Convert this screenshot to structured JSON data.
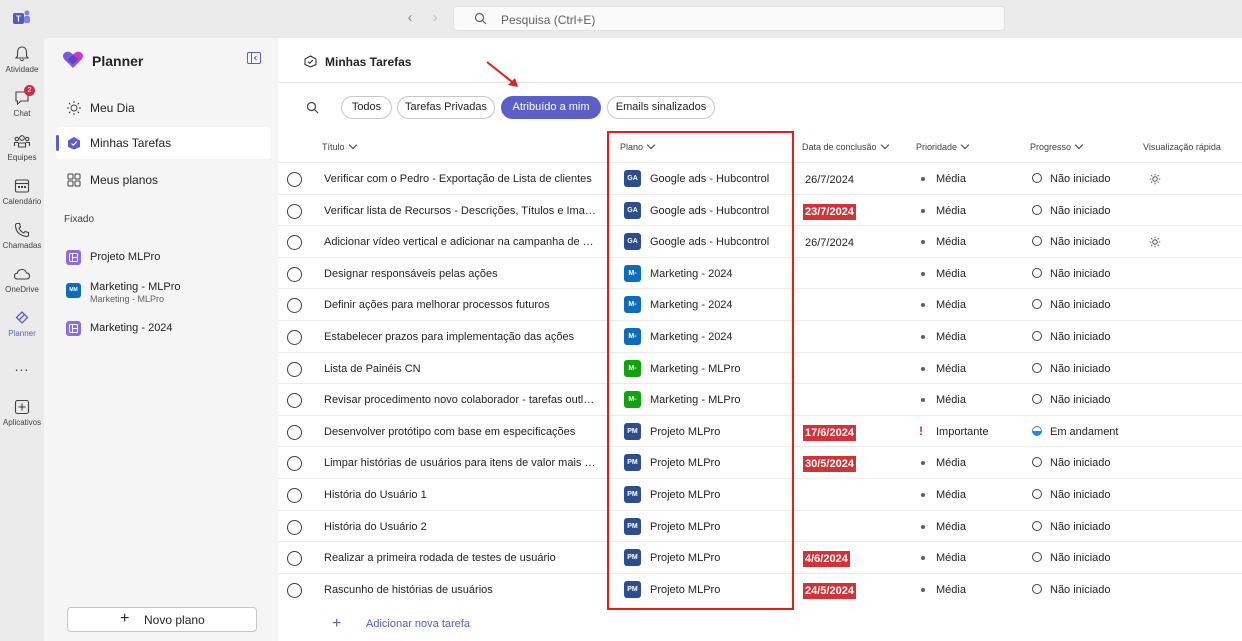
{
  "search": {
    "placeholder": "Pesquisa (Ctrl+E)"
  },
  "rail": [
    {
      "label": "Atividade",
      "icon": "bell-icon"
    },
    {
      "label": "Chat",
      "icon": "chat-icon",
      "badge": "2"
    },
    {
      "label": "Equipes",
      "icon": "teams-icon"
    },
    {
      "label": "Calendário",
      "icon": "calendar-icon"
    },
    {
      "label": "Chamadas",
      "icon": "phone-icon"
    },
    {
      "label": "OneDrive",
      "icon": "cloud-icon"
    },
    {
      "label": "Planner",
      "icon": "planner-icon"
    },
    {
      "label": "...",
      "icon": "more-icon"
    },
    {
      "label": "Aplicativos",
      "icon": "add-app-icon"
    }
  ],
  "nav": {
    "title": "Planner",
    "items": [
      {
        "label": "Meu Dia"
      },
      {
        "label": "Minhas Tarefas"
      },
      {
        "label": "Meus planos"
      }
    ],
    "section": "Fixado",
    "pinned": [
      {
        "label": "Projeto MLPro",
        "sub": ""
      },
      {
        "label": "Marketing - MLPro",
        "sub": "Marketing - MLPro",
        "badge": "MM"
      },
      {
        "label": "Marketing - 2024",
        "sub": ""
      }
    ],
    "new_plan": "Novo plano"
  },
  "main": {
    "title": "Minhas Tarefas",
    "filters": [
      "Todos",
      "Tarefas Privadas",
      "Atribuído a mim",
      "Emails sinalizados"
    ],
    "columns": {
      "title": "Título",
      "plan": "Plano",
      "due": "Data de conclusão",
      "priority": "Prioridade",
      "progress": "Progresso",
      "quick": "Visualização rápida"
    },
    "add_task": "Adicionar nova tarefa"
  },
  "colors": {
    "accent": "#5b5fc7",
    "late": "#d13438",
    "annotation": "#e02020"
  },
  "tasks": [
    {
      "title": "Verificar com o Pedro - Exportação de Lista de clientes",
      "plan_badge": "GA",
      "plan_color": "#2e4d8f",
      "plan": "Google ads - Hubcontrol",
      "due": "26/7/2024",
      "late": false,
      "priority": "Média",
      "important": false,
      "progress": "Não iniciado",
      "half": false,
      "quick": true
    },
    {
      "title": "Verificar lista de Recursos - Descrições, Títulos e Imagens",
      "plan_badge": "GA",
      "plan_color": "#2e4d8f",
      "plan": "Google ads - Hubcontrol",
      "due": "23/7/2024",
      "late": true,
      "priority": "Média",
      "important": false,
      "progress": "Não iniciado",
      "half": false,
      "quick": false
    },
    {
      "title": "Adicionar vídeo vertical e adicionar na campanha de Leads",
      "plan_badge": "GA",
      "plan_color": "#2e4d8f",
      "plan": "Google ads - Hubcontrol",
      "due": "26/7/2024",
      "late": false,
      "priority": "Média",
      "important": false,
      "progress": "Não iniciado",
      "half": false,
      "quick": true
    },
    {
      "title": "Designar responsáveis pelas ações",
      "plan_badge": "M-",
      "plan_color": "#0f6cbd",
      "plan": "Marketing - 2024",
      "due": "",
      "late": false,
      "priority": "Média",
      "important": false,
      "progress": "Não iniciado",
      "half": false,
      "quick": false
    },
    {
      "title": "Definir ações para melhorar processos futuros",
      "plan_badge": "M-",
      "plan_color": "#0f6cbd",
      "plan": "Marketing - 2024",
      "due": "",
      "late": false,
      "priority": "Média",
      "important": false,
      "progress": "Não iniciado",
      "half": false,
      "quick": false
    },
    {
      "title": "Estabelecer prazos para implementação das ações",
      "plan_badge": "M-",
      "plan_color": "#0f6cbd",
      "plan": "Marketing - 2024",
      "due": "",
      "late": false,
      "priority": "Média",
      "important": false,
      "progress": "Não iniciado",
      "half": false,
      "quick": false
    },
    {
      "title": "Lista de Painéis CN",
      "plan_badge": "M-",
      "plan_color": "#13a10e",
      "plan": "Marketing - MLPro",
      "due": "",
      "late": false,
      "priority": "Média",
      "important": false,
      "progress": "Não iniciado",
      "half": false,
      "quick": false
    },
    {
      "title": "Revisar procedimento novo colaborador - tarefas outlook",
      "plan_badge": "M-",
      "plan_color": "#13a10e",
      "plan": "Marketing - MLPro",
      "due": "",
      "late": false,
      "priority": "Média",
      "important": false,
      "progress": "Não iniciado",
      "half": false,
      "quick": false
    },
    {
      "title": "Desenvolver protótipo com base em especificações",
      "plan_badge": "PM",
      "plan_color": "#2e4d8f",
      "plan": "Projeto MLPro",
      "due": "17/6/2024",
      "late": true,
      "priority": "Importante",
      "important": true,
      "progress": "Em andament",
      "half": true,
      "quick": false
    },
    {
      "title": "Limpar histórias de usuários para itens de valor mais alto",
      "plan_badge": "PM",
      "plan_color": "#2e4d8f",
      "plan": "Projeto MLPro",
      "due": "30/5/2024",
      "late": true,
      "priority": "Média",
      "important": false,
      "progress": "Não iniciado",
      "half": false,
      "quick": false
    },
    {
      "title": "História do Usuário 1",
      "plan_badge": "PM",
      "plan_color": "#2e4d8f",
      "plan": "Projeto MLPro",
      "due": "",
      "late": false,
      "priority": "Média",
      "important": false,
      "progress": "Não iniciado",
      "half": false,
      "quick": false
    },
    {
      "title": "História do Usuário 2",
      "plan_badge": "PM",
      "plan_color": "#2e4d8f",
      "plan": "Projeto MLPro",
      "due": "",
      "late": false,
      "priority": "Média",
      "important": false,
      "progress": "Não iniciado",
      "half": false,
      "quick": false
    },
    {
      "title": "Realizar a primeira rodada de testes de usuário",
      "plan_badge": "PM",
      "plan_color": "#2e4d8f",
      "plan": "Projeto MLPro",
      "due": "4/6/2024",
      "late": true,
      "priority": "Média",
      "important": false,
      "progress": "Não iniciado",
      "half": false,
      "quick": false
    },
    {
      "title": "Rascunho de histórias de usuários",
      "plan_badge": "PM",
      "plan_color": "#2e4d8f",
      "plan": "Projeto MLPro",
      "due": "24/5/2024",
      "late": true,
      "priority": "Média",
      "important": false,
      "progress": "Não iniciado",
      "half": false,
      "quick": false
    }
  ]
}
